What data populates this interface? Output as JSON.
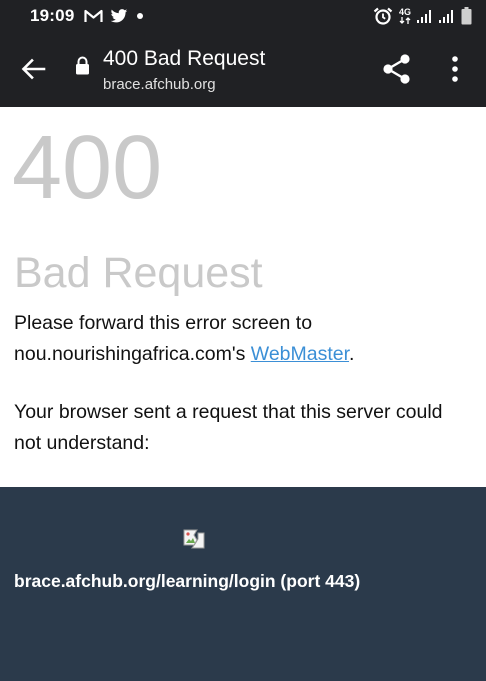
{
  "status_bar": {
    "time": "19:09",
    "network_label": "4G",
    "left_icons": [
      "gmail-icon",
      "twitter-icon",
      "dot-icon"
    ],
    "right_icons": [
      "alarm-icon",
      "network-4g-icon",
      "signal-icon",
      "signal-icon",
      "battery-icon"
    ]
  },
  "browser": {
    "title": "400 Bad Request",
    "url": "brace.afchub.org"
  },
  "page": {
    "code": "400",
    "title": "Bad Request",
    "forward_text": "Please forward this error screen to nou.nourishingafrica.com's ",
    "webmaster_link": "WebMaster",
    "forward_end": ".",
    "detail_text": "Your browser sent a request that this server could not understand:",
    "request_url": "brace.afchub.org/learning/login (port 443)"
  },
  "colors": {
    "bar_bg": "#202124",
    "error_gray": "#c9c9c9",
    "link": "#3b8fd6",
    "footer_bg": "#2b3a4b"
  }
}
